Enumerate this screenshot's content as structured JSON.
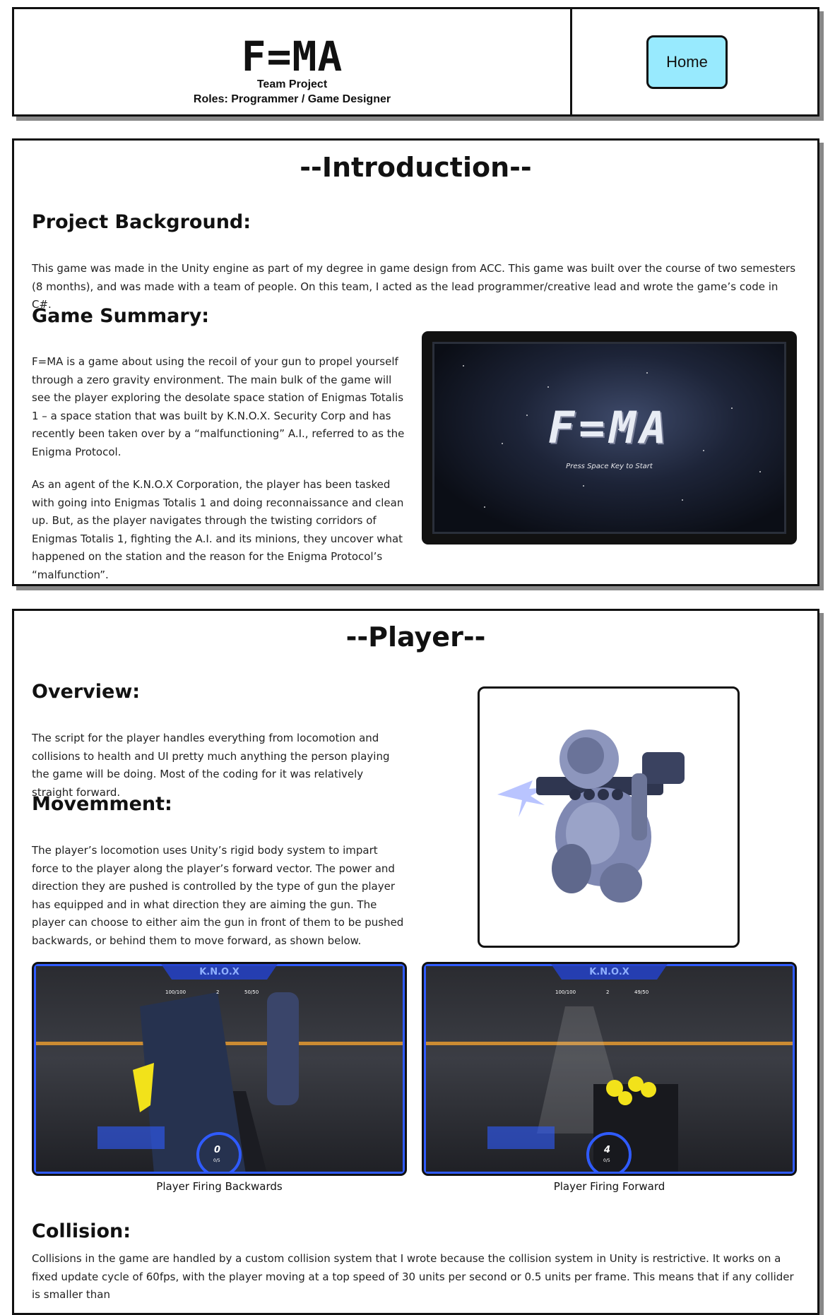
{
  "header": {
    "title": "F=MA",
    "subtitle": "Team Project",
    "roles": "Roles: Programmer / Game Designer",
    "home_label": "Home"
  },
  "intro": {
    "section_title": "--Introduction--",
    "background_heading": "Project Background:",
    "background_text": "This game was made in the Unity engine as part of my degree in game design from ACC. This game was built over the course of two semesters (8 months), and was made with a team of people.  On this team, I acted as the lead programmer/creative lead and wrote the game’s code in C#.",
    "summary_heading": "Game Summary:",
    "summary_p1": "F=MA is a game about using the recoil of your gun to propel yourself through a zero gravity environment. The main bulk of the game will see the player exploring the desolate space station of Enigmas Totalis 1 – a space station that was built by K.N.O.X. Security Corp and has recently been taken over by a “malfunctioning” A.I., referred to as the Enigma Protocol.",
    "summary_p2": "As an agent of the K.N.O.X Corporation, the player has been tasked with going into Enigmas Totalis 1 and doing reconnaissance and clean up.  But, as the player navigates through the twisting corridors of Enigmas Totalis 1, fighting the A.I. and its minions, they uncover what happened on the station and the reason for the Enigma Protocol’s “malfunction”.",
    "title_screen_logo": "F=MA",
    "title_screen_prompt": "Press Space Key to Start"
  },
  "player": {
    "section_title": "--Player--",
    "overview_heading": "Overview:",
    "overview_text": "The script for the player handles everything from locomotion and collisions to health and UI pretty much anything the person playing the game will be doing. Most of the coding for it was relatively straight forward.",
    "movement_heading": "Movemment:",
    "movement_text": "The player’s locomotion uses Unity’s rigid body system to impart force to the player along the player’s forward vector.  The power and direction they are pushed is controlled by the type of gun the player has equipped and in what direction they are aiming the gun. The player can choose to either aim the gun in front of them to be pushed backwards, or behind them to move forward, as shown below.",
    "caption_back": "Player Firing Backwards",
    "caption_forward": "Player Firing Forward",
    "hud_brand": "K.N.O.X",
    "hud_back": {
      "health": "100/100",
      "mid": "2",
      "shield": "50/50",
      "ammo": "0",
      "ammo_sub": "0/5"
    },
    "hud_fwd": {
      "health": "100/100",
      "mid": "2",
      "shield": "49/50",
      "ammo": "4",
      "ammo_sub": "0/5"
    },
    "collision_heading": "Collision:",
    "collision_text": "Collisions in the game are handled by a custom collision system that I wrote because the collision system in Unity is restrictive.  It works on a fixed update cycle of 60fps, with the player moving at a top speed of 30 units per second or 0.5 units per frame. This means that if any collider is smaller than"
  },
  "colors": {
    "home_button": "#98eafe",
    "hud_blue": "#2f5bff",
    "hud_accent": "#f0a030",
    "gun_yellow": "#f2e21a"
  }
}
